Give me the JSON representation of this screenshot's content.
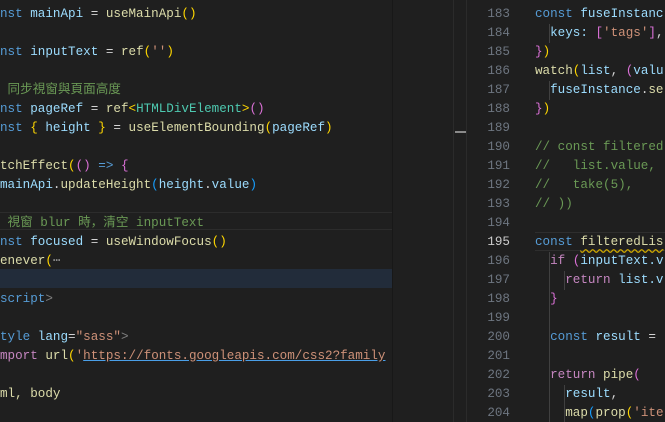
{
  "left_editor": {
    "lines": [
      [
        [
          "nst ",
          "kw"
        ],
        [
          "mainApi",
          "var"
        ],
        [
          " = ",
          "pl"
        ],
        [
          "useMainApi",
          "fn"
        ],
        [
          "()",
          "b1"
        ]
      ],
      [],
      [
        [
          "nst ",
          "kw"
        ],
        [
          "inputText",
          "var"
        ],
        [
          " = ",
          "pl"
        ],
        [
          "ref",
          "fn"
        ],
        [
          "(",
          "b1"
        ],
        [
          "''",
          "str"
        ],
        [
          ")",
          "b1"
        ]
      ],
      [],
      [
        [
          " 同步視窗與頁面高度",
          "cm"
        ]
      ],
      [
        [
          "nst ",
          "kw"
        ],
        [
          "pageRef",
          "var"
        ],
        [
          " = ",
          "pl"
        ],
        [
          "ref",
          "fn"
        ],
        [
          "<",
          "b1"
        ],
        [
          "HTMLDivElement",
          "ty"
        ],
        [
          ">",
          "b1"
        ],
        [
          "()",
          "b2"
        ]
      ],
      [
        [
          "nst ",
          "kw"
        ],
        [
          "{",
          "b1"
        ],
        [
          " height ",
          "var"
        ],
        [
          "}",
          "b1"
        ],
        [
          " = ",
          "pl"
        ],
        [
          "useElementBounding",
          "fn"
        ],
        [
          "(",
          "b1"
        ],
        [
          "pageRef",
          "var"
        ],
        [
          ")",
          "b1"
        ]
      ],
      [],
      [
        [
          "tchEffect",
          "fn"
        ],
        [
          "(",
          "b1"
        ],
        [
          "()",
          "b2"
        ],
        [
          " => ",
          "kw"
        ],
        [
          "{",
          "b2"
        ]
      ],
      [
        [
          "mainApi",
          "var"
        ],
        [
          ".",
          "pl"
        ],
        [
          "updateHeight",
          "fn"
        ],
        [
          "(",
          "b3"
        ],
        [
          "height",
          "var"
        ],
        [
          ".",
          "pl"
        ],
        [
          "value",
          "var"
        ],
        [
          ")",
          "b3"
        ]
      ],
      [],
      [
        [
          " 視窗 blur 時，清空 inputText",
          "cm"
        ]
      ],
      [
        [
          "nst ",
          "kw"
        ],
        [
          "focused",
          "var"
        ],
        [
          " = ",
          "pl"
        ],
        [
          "useWindowFocus",
          "fn"
        ],
        [
          "()",
          "b1"
        ]
      ],
      [
        [
          "enever",
          "fn"
        ],
        [
          "(",
          "b1"
        ],
        [
          "⋯",
          "fold"
        ]
      ],
      [],
      [
        [
          "script",
          "tn"
        ],
        [
          ">",
          "tag"
        ]
      ],
      [],
      [
        [
          "tyle ",
          "tn"
        ],
        [
          "lang",
          "at"
        ],
        [
          "=",
          "pl"
        ],
        [
          "\"sass\"",
          "str"
        ],
        [
          ">",
          "tag"
        ]
      ],
      [
        [
          "mport ",
          "ctl"
        ],
        [
          "url",
          "fn"
        ],
        [
          "(",
          "b1"
        ],
        [
          "'",
          "str"
        ],
        [
          "https://fonts.googleapis.com/css2?family",
          "url"
        ]
      ],
      [],
      [
        [
          "ml, body",
          "fn"
        ]
      ]
    ]
  },
  "right_editor": {
    "line_numbers": [
      "183",
      "184",
      "185",
      "186",
      "187",
      "188",
      "189",
      "190",
      "191",
      "192",
      "193",
      "194",
      "195",
      "196",
      "197",
      "198",
      "199",
      "200",
      "201",
      "202",
      "203",
      "204"
    ],
    "active_line": "195",
    "lines": [
      [
        [
          "const ",
          "kw"
        ],
        [
          "fuseInstanc",
          "var"
        ]
      ],
      [
        [
          "  keys: ",
          "var"
        ],
        [
          "[",
          "b2"
        ],
        [
          "'tags'",
          "str"
        ],
        [
          "]",
          "b2"
        ],
        [
          ",",
          "pl"
        ]
      ],
      [
        [
          "}",
          "b2"
        ],
        [
          ")",
          "b1"
        ]
      ],
      [
        [
          "watch",
          "fn"
        ],
        [
          "(",
          "b1"
        ],
        [
          "list",
          "var"
        ],
        [
          ", ",
          "pl"
        ],
        [
          "(",
          "b2"
        ],
        [
          "valu",
          "var"
        ]
      ],
      [
        [
          "  fuseInstance",
          "var"
        ],
        [
          ".",
          "pl"
        ],
        [
          "se",
          "fn"
        ]
      ],
      [
        [
          "}",
          "b2"
        ],
        [
          ")",
          "b1"
        ]
      ],
      [],
      [
        [
          "// const filtered",
          "cm"
        ]
      ],
      [
        [
          "//   list.value,",
          "cm"
        ]
      ],
      [
        [
          "//   take(5),",
          "cm"
        ]
      ],
      [
        [
          "// ))",
          "cm"
        ]
      ],
      [],
      [
        [
          "const ",
          "kw"
        ],
        [
          "filteredLis",
          "fn sq"
        ]
      ],
      [
        [
          "  if ",
          "ctl"
        ],
        [
          "(",
          "b2"
        ],
        [
          "inputText",
          "var"
        ],
        [
          ".v",
          "var"
        ]
      ],
      [
        [
          "    return ",
          "ctl"
        ],
        [
          "list",
          "var"
        ],
        [
          ".v",
          "var"
        ]
      ],
      [
        [
          "  }",
          "b2"
        ]
      ],
      [],
      [
        [
          "  const ",
          "kw"
        ],
        [
          "result",
          "var"
        ],
        [
          " =",
          "pl"
        ]
      ],
      [],
      [
        [
          "  return ",
          "ctl"
        ],
        [
          "pipe",
          "fn"
        ],
        [
          "(",
          "b2"
        ]
      ],
      [
        [
          "    result",
          "var"
        ],
        [
          ",",
          "pl"
        ]
      ],
      [
        [
          "    map",
          "fn"
        ],
        [
          "(",
          "b3"
        ],
        [
          "prop",
          "fn"
        ],
        [
          "(",
          "b1"
        ],
        [
          "'ite",
          "str"
        ]
      ]
    ]
  }
}
